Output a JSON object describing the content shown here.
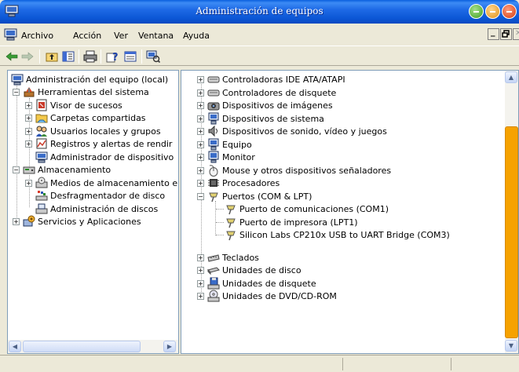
{
  "window": {
    "title": "Administración de equipos"
  },
  "menu": {
    "items": [
      "Archivo",
      "Acción",
      "Ver",
      "Ventana",
      "Ayuda"
    ],
    "mdi_min": "_",
    "mdi_restore": "▫",
    "mdi_close": "✕"
  },
  "toolbar": {
    "buttons": [
      "back-icon",
      "forward-icon",
      "up-folder-icon",
      "show-hide-tree-icon",
      "print-icon",
      "help-icon",
      "properties-icon",
      "scan-hardware-icon"
    ]
  },
  "tree": {
    "root": "Administración del equipo (local)",
    "tools": "Herramientas del sistema",
    "event_viewer": "Visor de sucesos",
    "shared_folders": "Carpetas compartidas",
    "users_groups": "Usuarios locales y grupos",
    "perf_logs": "Registros y alertas de rendir",
    "device_manager": "Administrador de dispositivo",
    "storage": "Almacenamiento",
    "removable_storage": "Medios de almacenamiento e",
    "defrag": "Desfragmentador de disco",
    "disk_mgmt": "Administración de discos",
    "services_apps": "Servicios y Aplicaciones"
  },
  "devices": {
    "ide": "Controladoras IDE ATA/ATAPI",
    "floppy_ctrl": "Controladores de disquete",
    "imaging": "Dispositivos de imágenes",
    "system": "Dispositivos de sistema",
    "sound": "Dispositivos de sonido, vídeo y juegos",
    "computer": "Equipo",
    "monitor": "Monitor",
    "mouse": "Mouse y otros dispositivos señaladores",
    "processors": "Procesadores",
    "ports": "Puertos (COM & LPT)",
    "com1": "Puerto de comunicaciones (COM1)",
    "lpt1": "Puerto de impresora (LPT1)",
    "cp210x": "Silicon Labs CP210x USB to UART Bridge (COM3)",
    "keyboards": "Teclados",
    "disk_drives": "Unidades de disco",
    "floppy_drives": "Unidades de disquete",
    "dvd": "Unidades de DVD/CD-ROM"
  },
  "expander": {
    "plus": "+",
    "minus": "−"
  },
  "colors": {
    "accent": "#0a5fde",
    "scroll_thumb": "#f6a200"
  }
}
